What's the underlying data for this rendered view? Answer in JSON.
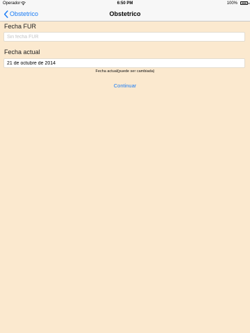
{
  "status_bar": {
    "carrier": "Operador",
    "wifi_icon": "wifi-icon",
    "time": "6:50 PM",
    "battery_percent": "100%",
    "battery_icon": "battery-icon"
  },
  "nav": {
    "back_label": "Obstetrico",
    "back_icon": "chevron-left-icon",
    "title": "Obstetrico"
  },
  "form": {
    "fur_label": "Fecha FUR",
    "fur_value": "",
    "fur_placeholder": "Sin fecha FUR",
    "actual_label": "Fecha actual",
    "actual_value": "21 de octubre de 2014",
    "actual_hint": "Fecha actual(puede ser cambiada)",
    "continue_label": "Continuar"
  },
  "colors": {
    "background": "#fbe9cf",
    "accent": "#1a7cf6",
    "bar": "#f7f7f7"
  }
}
